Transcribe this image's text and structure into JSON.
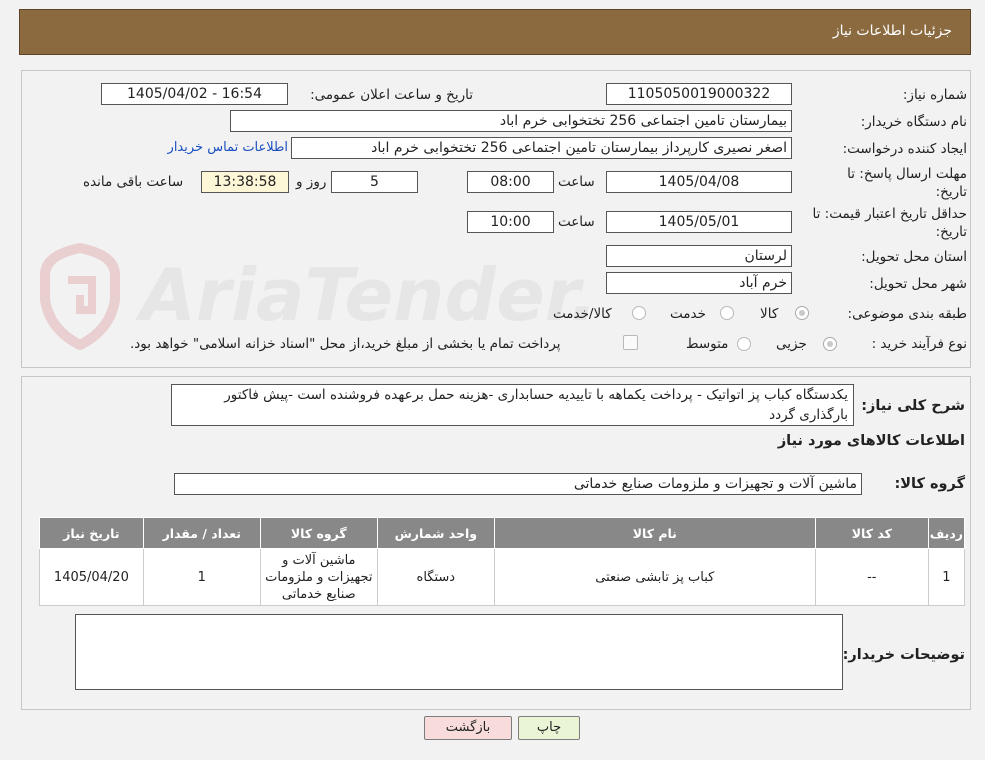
{
  "header": {
    "title": "جزئیات اطلاعات نیاز"
  },
  "form": {
    "need_number_label": "شماره نیاز:",
    "need_number": "1105050019000322",
    "announce_label": "تاریخ و ساعت اعلان عمومی:",
    "announce_value": "1405/04/02 - 16:54",
    "buyer_org_label": "نام دستگاه خریدار:",
    "buyer_org": "بیمارستان تامین اجتماعی  256 تختخوابی خرم اباد",
    "requester_label": "ایجاد کننده درخواست:",
    "requester": "اصغر نصیری کارپرداز بیمارستان تامین اجتماعی  256 تختخوابی خرم اباد",
    "contact_link": "اطلاعات تماس خریدار",
    "deadline_label_1": "مهلت ارسال پاسخ: تا",
    "deadline_label_2": "تاریخ:",
    "deadline_date": "1405/04/08",
    "time_label": "ساعت",
    "deadline_time": "08:00",
    "days_value": "5",
    "days_label": "روز و",
    "remaining_time": "13:38:58",
    "remaining_label": "ساعت باقی مانده",
    "validity_label_1": "حداقل تاریخ اعتبار قیمت: تا",
    "validity_label_2": "تاریخ:",
    "validity_date": "1405/05/01",
    "validity_time": "10:00",
    "province_label": "استان محل تحویل:",
    "province": "لرستان",
    "city_label": "شهر محل تحویل:",
    "city": "خرم آباد",
    "category_label": "طبقه بندی موضوعی:",
    "category_options": [
      "کالا",
      "خدمت",
      "کالا/خدمت"
    ],
    "process_label": "نوع فرآیند خرید :",
    "process_options": [
      "جزیی",
      "متوسط"
    ],
    "payment_note": "پرداخت تمام یا بخشی از مبلغ خرید،از محل \"اسناد خزانه اسلامی\" خواهد بود."
  },
  "description": {
    "label": "شرح کلی نیاز:",
    "text": "یکدستگاه کباب پز اتواتیک - پرداخت یکماهه با تاییدیه حسابداری -هزینه حمل برعهده فروشنده است -پیش فاکتور بارگذاری گردد",
    "goods_info_title": "اطلاعات کالاهای مورد نیاز",
    "goods_group_label": "گروه کالا:",
    "goods_group": "ماشین آلات و تجهیزات و ملزومات صنایع خدماتی"
  },
  "table": {
    "headers": [
      "ردیف",
      "کد کالا",
      "نام کالا",
      "واحد شمارش",
      "گروه کالا",
      "تعداد / مقدار",
      "تاریخ نیاز"
    ],
    "rows": [
      [
        "1",
        "--",
        "کباب پز تابشی صنعتی",
        "دستگاه",
        "ماشین آلات و تجهیزات و ملزومات صنایع خدماتی",
        "1",
        "1405/04/20"
      ]
    ]
  },
  "buyer_notes": {
    "label": "توضیحات خریدار:",
    "value": ""
  },
  "buttons": {
    "print": "چاپ",
    "back": "بازگشت"
  },
  "colors": {
    "header_bg": "#8c6a3f",
    "table_header_bg": "#888888",
    "back_button_bg": "#f8dcdc",
    "print_button_bg": "#eaf5d6"
  }
}
